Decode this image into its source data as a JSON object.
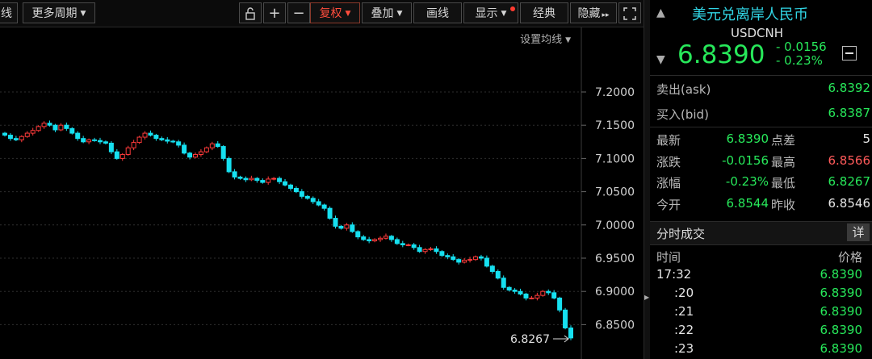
{
  "toolbar": {
    "line_label": "线",
    "period_label": "更多周期",
    "plus": "+",
    "minus": "−",
    "fuquan": "复权",
    "overlay": "叠加",
    "draw": "画线",
    "display": "显示",
    "classic": "经典",
    "hide": "隐藏",
    "hide_arrows": "▸▸",
    "expand": "⛶"
  },
  "chart": {
    "ma_settings": "设置均线",
    "low_annotation": "6.8267",
    "colors": {
      "up": "#ff3b3b",
      "down": "#16e0f0",
      "grid": "#2e2e2e"
    }
  },
  "chart_data": {
    "type": "candlestick",
    "yticks": [
      "7.2000",
      "7.1500",
      "7.1000",
      "7.0500",
      "7.0000",
      "6.9500",
      "6.9000",
      "6.8500"
    ],
    "ylim": [
      6.82,
      7.22
    ],
    "closes": [
      7.135,
      7.13,
      7.128,
      7.133,
      7.138,
      7.142,
      7.148,
      7.153,
      7.15,
      7.143,
      7.15,
      7.145,
      7.138,
      7.13,
      7.125,
      7.128,
      7.127,
      7.125,
      7.123,
      7.11,
      7.1,
      7.106,
      7.116,
      7.124,
      7.132,
      7.138,
      7.135,
      7.13,
      7.128,
      7.126,
      7.125,
      7.12,
      7.108,
      7.102,
      7.106,
      7.11,
      7.116,
      7.122,
      7.118,
      7.1,
      7.08,
      7.072,
      7.07,
      7.068,
      7.07,
      7.067,
      7.064,
      7.069,
      7.07,
      7.065,
      7.06,
      7.055,
      7.05,
      7.043,
      7.04,
      7.035,
      7.03,
      7.025,
      7.01,
      6.998,
      6.995,
      7.0,
      6.99,
      6.982,
      6.978,
      6.976,
      6.978,
      6.98,
      6.983,
      6.978,
      6.972,
      6.97,
      6.97,
      6.966,
      6.96,
      6.963,
      6.964,
      6.96,
      6.954,
      6.952,
      6.948,
      6.944,
      6.947,
      6.948,
      6.952,
      6.95,
      6.938,
      6.93,
      6.92,
      6.906,
      6.902,
      6.9,
      6.896,
      6.89,
      6.89,
      6.894,
      6.9,
      6.898,
      6.89,
      6.872,
      6.845,
      6.83
    ]
  },
  "quote": {
    "name": "美元兑离岸人民币",
    "code": "USDCNH",
    "price": "6.8390",
    "change": "- 0.0156",
    "change_pct": "- 0.23%",
    "ask_label": "卖出(ask)",
    "ask": "6.8392",
    "bid_label": "买入(bid)",
    "bid": "6.8387",
    "latest_label": "最新",
    "latest": "6.8390",
    "spread_label": "点差",
    "spread": "5",
    "chg_label": "涨跌",
    "chg": "-0.0156",
    "high_label": "最高",
    "high": "6.8566",
    "pct_label": "涨幅",
    "pct": "-0.23%",
    "low_label": "最低",
    "low": "6.8267",
    "open_label": "今开",
    "open": "6.8544",
    "prev_label": "昨收",
    "prev": "6.8546"
  },
  "trades": {
    "title": "分时成交",
    "detail": "详",
    "time_col": "时间",
    "price_col": "价格",
    "rows": [
      {
        "time": "17:32",
        "price": "6.8390"
      },
      {
        "time": ":20",
        "price": "6.8390"
      },
      {
        "time": ":21",
        "price": "6.8390"
      },
      {
        "time": ":22",
        "price": "6.8390"
      },
      {
        "time": ":23",
        "price": "6.8390"
      }
    ]
  }
}
